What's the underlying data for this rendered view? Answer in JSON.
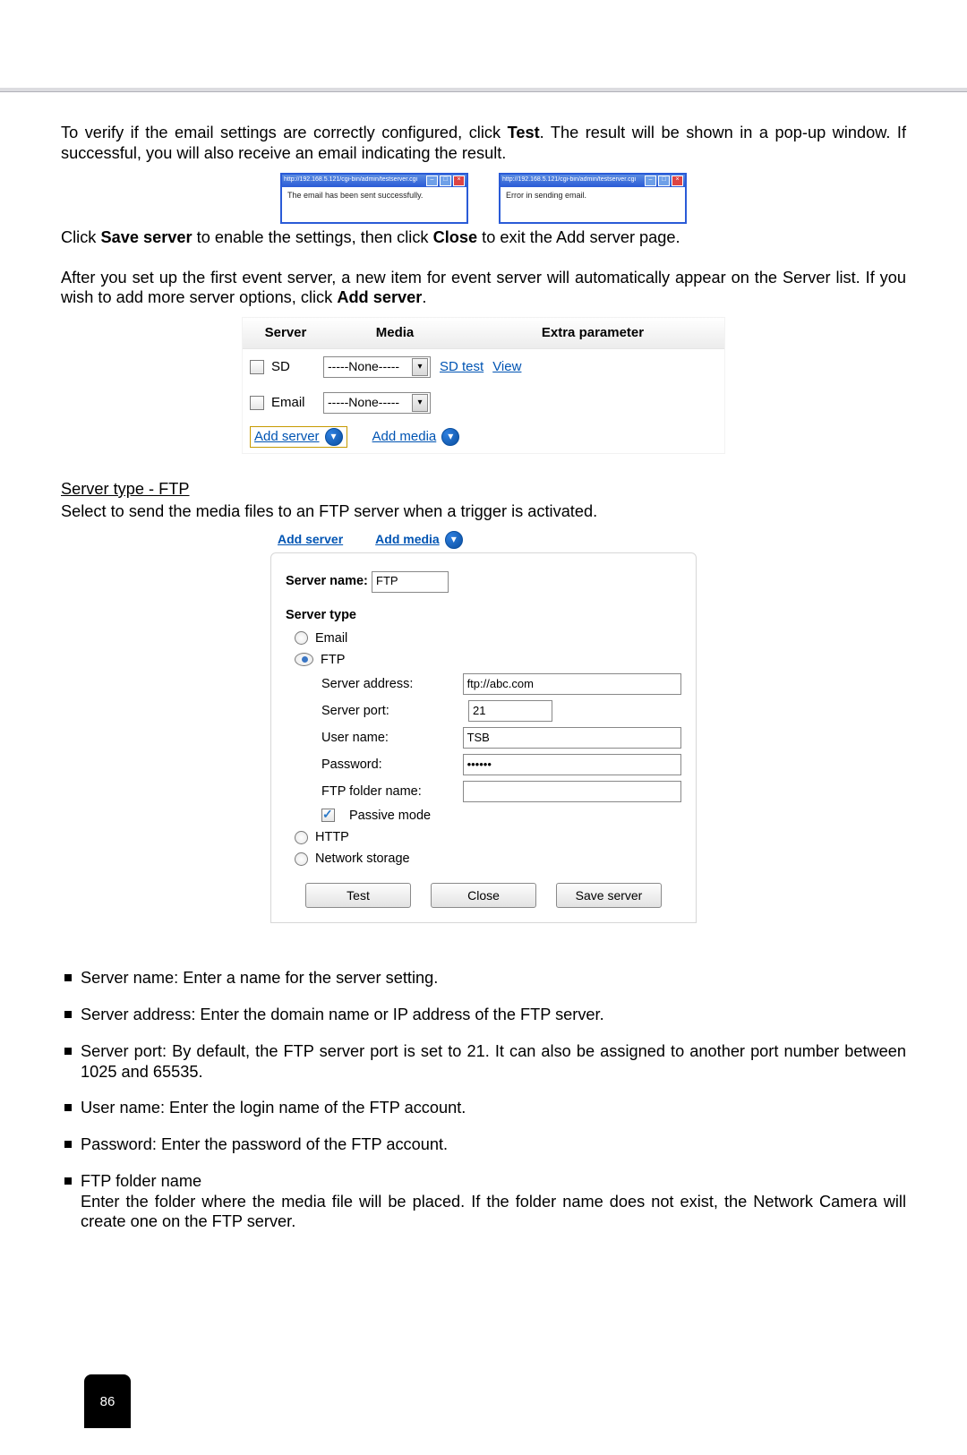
{
  "text": {
    "para1a": "To verify if the email settings are correctly configured, click ",
    "test": "Test",
    "para1b": ". The result will be shown in a pop-up window. If successful, you will also receive an email indicating the result.",
    "popup_url": "http://192.168.5.121/cgi-bin/admin/testserver.cgi",
    "popup_msg_success": "The email has been sent successfully.",
    "popup_msg_error": "Error in sending email.",
    "para2a": "Click ",
    "save_server": "Save server",
    "para2b": " to enable the settings, then click ",
    "close": "Close",
    "para2c": " to exit the Add server page.",
    "para3a": "After you set up the first event server, a new item for event server will automatically appear on the Server list. If you wish to add more server options, click ",
    "add_server": "Add server",
    "para3b": ".",
    "server_type_heading": "Server type - FTP",
    "para4": "Select to send the media files to an FTP server when a trigger is activated."
  },
  "fig1": {
    "head": {
      "c1": "Server",
      "c2": "Media",
      "c3": "Extra parameter"
    },
    "row1": {
      "name": "SD",
      "sel": "-----None-----",
      "link1": "SD test",
      "link2": "View"
    },
    "row2": {
      "name": "Email",
      "sel": "-----None-----"
    },
    "add_server": "Add server",
    "add_media": "Add media"
  },
  "fig2": {
    "add_server": "Add server",
    "add_media": "Add media",
    "server_name_label": "Server name:",
    "server_name_value": "FTP",
    "server_type_label": "Server type",
    "r_email": "Email",
    "r_ftp": "FTP",
    "server_address_label": "Server address:",
    "server_address_value": "ftp://abc.com",
    "server_port_label": "Server port:",
    "server_port_value": "21",
    "user_name_label": "User name:",
    "user_name_value": "TSB",
    "password_label": "Password:",
    "password_value": "••••••",
    "ftp_folder_label": "FTP folder name:",
    "ftp_folder_value": "",
    "passive_label": "Passive mode",
    "r_http": "HTTP",
    "r_netstorage": "Network storage",
    "btn_test": "Test",
    "btn_close": "Close",
    "btn_save": "Save server"
  },
  "bullets": {
    "b1": "Server name: Enter a name for the server setting.",
    "b2": "Server address: Enter the domain name or IP address of the FTP server.",
    "b3": "Server port: By default, the FTP server port is set to 21. It can also be assigned to another port number between 1025 and 65535.",
    "b4": "User name: Enter the login name of the FTP account.",
    "b5": "Password: Enter the password of the FTP account.",
    "b6_title": "FTP folder name",
    "b6_body": "Enter the folder where the media file will be placed. If the folder name does not exist, the Network Camera will create one on the FTP server."
  },
  "page_number": "86"
}
